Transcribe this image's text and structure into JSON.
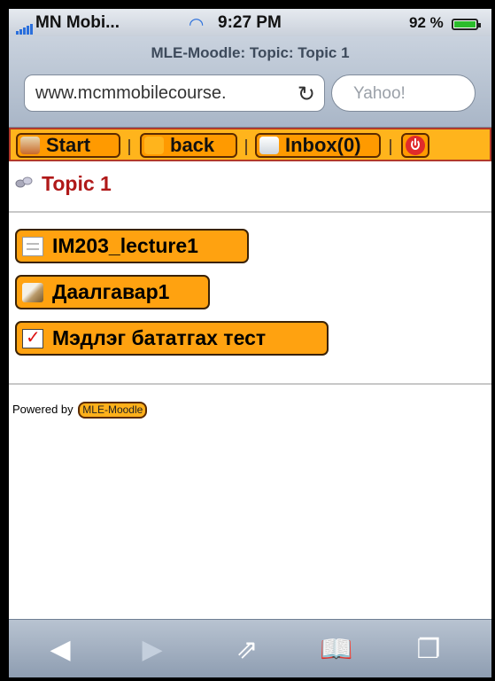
{
  "status": {
    "carrier": "MN Mobi...",
    "time": "9:27 PM",
    "battery": "92 %",
    "battery_level": 0.92
  },
  "browser": {
    "page_title": "MLE-Moodle: Topic: Topic 1",
    "url": "www.mcmmobilecourse.",
    "search_placeholder": "Yahoo!"
  },
  "nav": {
    "start": "Start",
    "back": "back",
    "inbox": "Inbox(0)"
  },
  "topic": {
    "title": "Topic 1"
  },
  "activities": [
    {
      "label": "IM203_lecture1",
      "icon": "document-icon"
    },
    {
      "label": "Даалгавар1",
      "icon": "assignment-icon"
    },
    {
      "label": "Мэдлэг бататгах тест",
      "icon": "quiz-icon"
    }
  ],
  "footer": {
    "powered_by": "Powered by",
    "link": "MLE-Moodle"
  },
  "toolbar": {
    "back_glyph": "◀",
    "forward_glyph": "▶",
    "share_glyph": "⇗",
    "bookmarks_glyph": "📖",
    "tabs_glyph": "❐"
  },
  "colors": {
    "nav_bg": "#ffb41c",
    "button_bg": "#ff9a00",
    "topic_title": "#b01919"
  }
}
